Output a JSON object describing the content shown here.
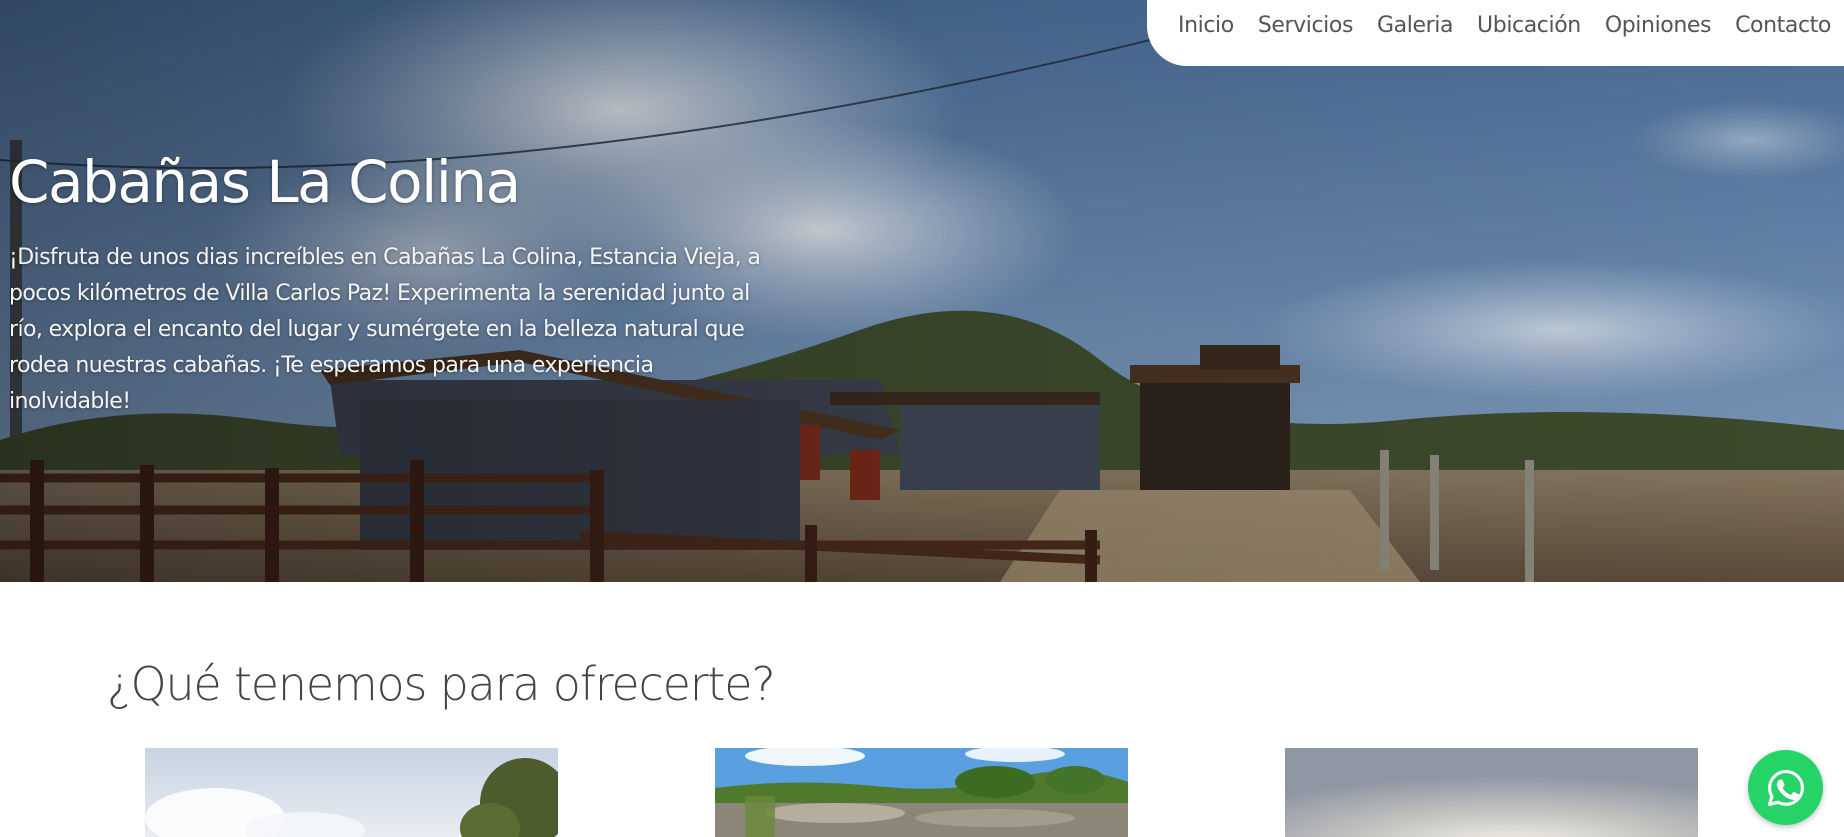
{
  "nav": {
    "items": [
      {
        "label": "Inicio"
      },
      {
        "label": "Servicios"
      },
      {
        "label": "Galeria"
      },
      {
        "label": "Ubicación"
      },
      {
        "label": "Opiniones"
      },
      {
        "label": "Contacto"
      }
    ]
  },
  "hero": {
    "title": "Cabañas La Colina",
    "description": "¡Disfruta de unos dias increíbles en Cabañas La Colina, Estancia Vieja, a pocos kilómetros de Villa Carlos Paz! Experimenta la serenidad junto al río, explora el encanto del lugar y sumérgete en la belleza natural que rodea nuestras cabañas. ¡Te esperamos para una experiencia inolvidable!"
  },
  "services": {
    "title": "¿Qué tenemos para ofrecerte?",
    "cards": [
      {
        "image": "cabin-exterior-photo"
      },
      {
        "image": "river-landscape-photo"
      },
      {
        "image": "sunset-sky-photo"
      }
    ]
  },
  "whatsapp": {
    "icon": "whatsapp-icon",
    "color": "#25d366"
  },
  "colors": {
    "nav_text": "#555555",
    "section_title": "#444444",
    "hero_text": "#ffffff"
  }
}
